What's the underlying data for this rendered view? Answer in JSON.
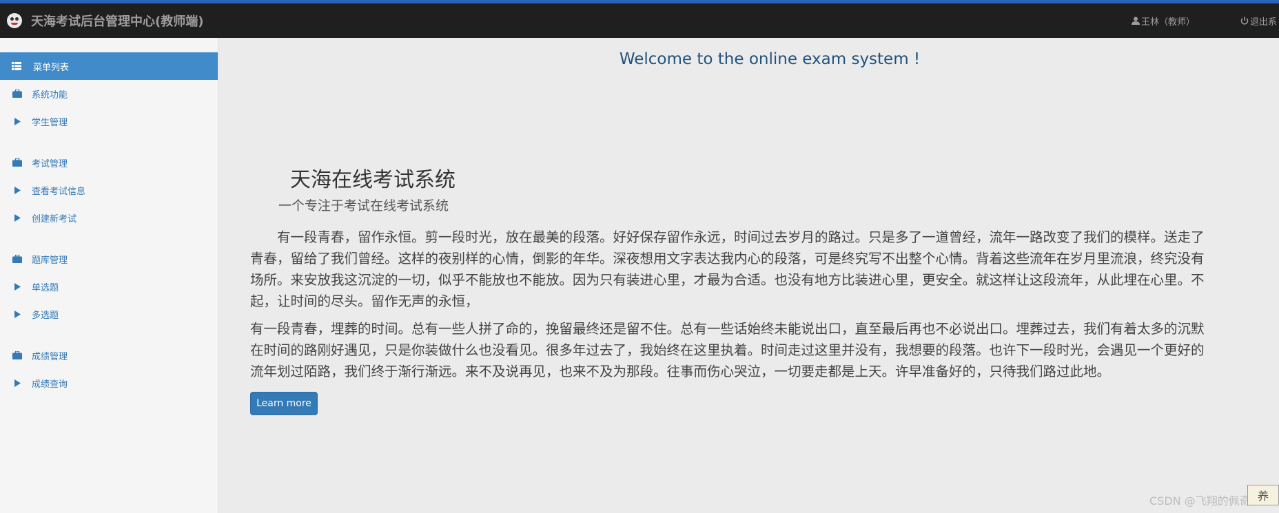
{
  "navbar": {
    "title": "天海考试后台管理中心(教师端)",
    "user": "王林（教师）",
    "logout": "退出系"
  },
  "sidebar": {
    "header": "菜单列表",
    "items": [
      {
        "label": "系统功能",
        "icon": "briefcase-icon"
      },
      {
        "label": "学生管理",
        "icon": "caret-right-icon"
      },
      {
        "label": "考试管理",
        "icon": "briefcase-icon"
      },
      {
        "label": "查看考试信息",
        "icon": "caret-right-icon"
      },
      {
        "label": "创建新考试",
        "icon": "caret-right-icon"
      },
      {
        "label": "题库管理",
        "icon": "briefcase-icon"
      },
      {
        "label": "单选题",
        "icon": "caret-right-icon"
      },
      {
        "label": "多选题",
        "icon": "caret-right-icon"
      },
      {
        "label": "成绩管理",
        "icon": "briefcase-icon"
      },
      {
        "label": "成绩查询",
        "icon": "caret-right-icon"
      }
    ]
  },
  "main": {
    "welcome": "Welcome to the online exam system !",
    "jumbotron": {
      "title": "天海在线考试系统",
      "subtitle": "一个专注于考试在线考试系统",
      "p1": [
        "　　有一段青春，留作永恒。剪一段时光，放在最美的段落。好好保存留作永远，时间过去岁月的路过。只是多了一道曾经，流年一路改变了我们的模样。送走了",
        "青春，留给了我们曾经。这样的夜别样的心情，倒影的年华。深夜想用文字表达我内心的段落，可是终究写不出整个心情。背着这些流年在岁月里流浪，终究没有",
        "场所。来安放我这沉淀的一切，似乎不能放也不能放。因为只有装进心里，才最为合适。也没有地方比装进心里，更安全。就这样让这段流年，从此埋在心里。不",
        "起，让时间的尽头。留作无声的永恒，"
      ],
      "p2": [
        "有一段青春，埋葬的时间。总有一些人拼了命的，挽留最终还是留不住。总有一些话始终未能说出口，直至最后再也不必说出口。埋葬过去，我们有着太多的沉默",
        "在时间的路刚好遇见，只是你装做什么也没看见。很多年过去了，我始终在这里执着。时间走过这里并没有，我想要的段落。也许下一段时光，会遇见一个更好的",
        "流年划过陌路，我们终于渐行渐远。来不及说再见，也来不及为那段。往事而伤心哭泣，一切要走都是上天。许早准备好的，只待我们路过此地。"
      ],
      "button": "Learn more"
    }
  },
  "watermark": "CSDN @飞翔的佩奇",
  "corner_badge": "养"
}
